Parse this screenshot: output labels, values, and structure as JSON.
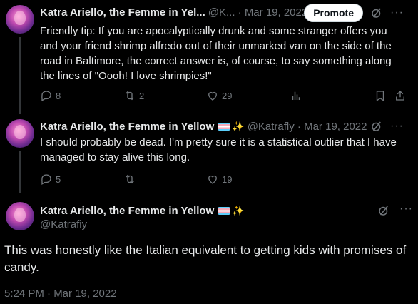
{
  "tweets": [
    {
      "name": "Katra Ariello, the Femme in Yel...",
      "meta": "@K... · Mar 19, 2022",
      "promote": "Promote",
      "text": "Friendly tip: If you are apocalyptically drunk and some stranger offers you and your friend shrimp alfredo out of their unmarked van on the side of the road in Baltimore, the correct answer is, of course, to say something along the lines of \"Oooh! I love shrimpies!\"",
      "replies": "8",
      "reposts": "2",
      "likes": "29"
    },
    {
      "name": "Katra Ariello, the Femme in Yellow",
      "meta": "@Katrafly · Mar 19, 2022",
      "text": "I should probably be dead. I'm pretty sure it is a statistical outlier that I have managed to stay alive this long.",
      "replies": "5",
      "reposts": "",
      "likes": "19"
    }
  ],
  "main": {
    "name": "Katra Ariello, the Femme in Yellow",
    "handle": "@Katrafiy",
    "text": "This was honestly like the Italian equivalent to getting kids with promises of candy.",
    "timestamp": "5:24 PM · Mar 19, 2022"
  },
  "icons": [
    "grok-icon",
    "more-icon",
    "reply-icon",
    "repost-icon",
    "like-icon",
    "views-icon",
    "bookmark-icon",
    "share-icon"
  ]
}
